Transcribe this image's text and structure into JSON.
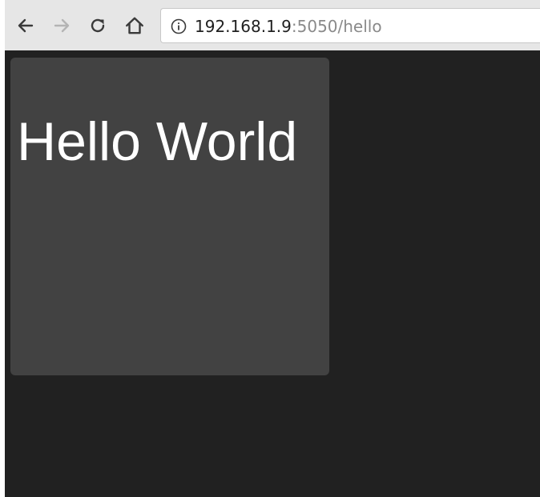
{
  "browser": {
    "nav": {
      "back_icon": "arrow-left-icon",
      "forward_icon": "arrow-right-icon",
      "reload_icon": "reload-icon",
      "home_icon": "home-icon"
    },
    "address_bar": {
      "info_icon": "info-icon",
      "host": "192.168.1.9",
      "rest": ":5050/hello"
    }
  },
  "page": {
    "card": {
      "title": "Hello World"
    }
  },
  "colors": {
    "toolbar": "#e6e6e6",
    "page_background": "#212121",
    "card_background": "#424242",
    "title_text": "#ffffff",
    "url_host": "#202020",
    "url_rest": "#8a8a8a"
  }
}
